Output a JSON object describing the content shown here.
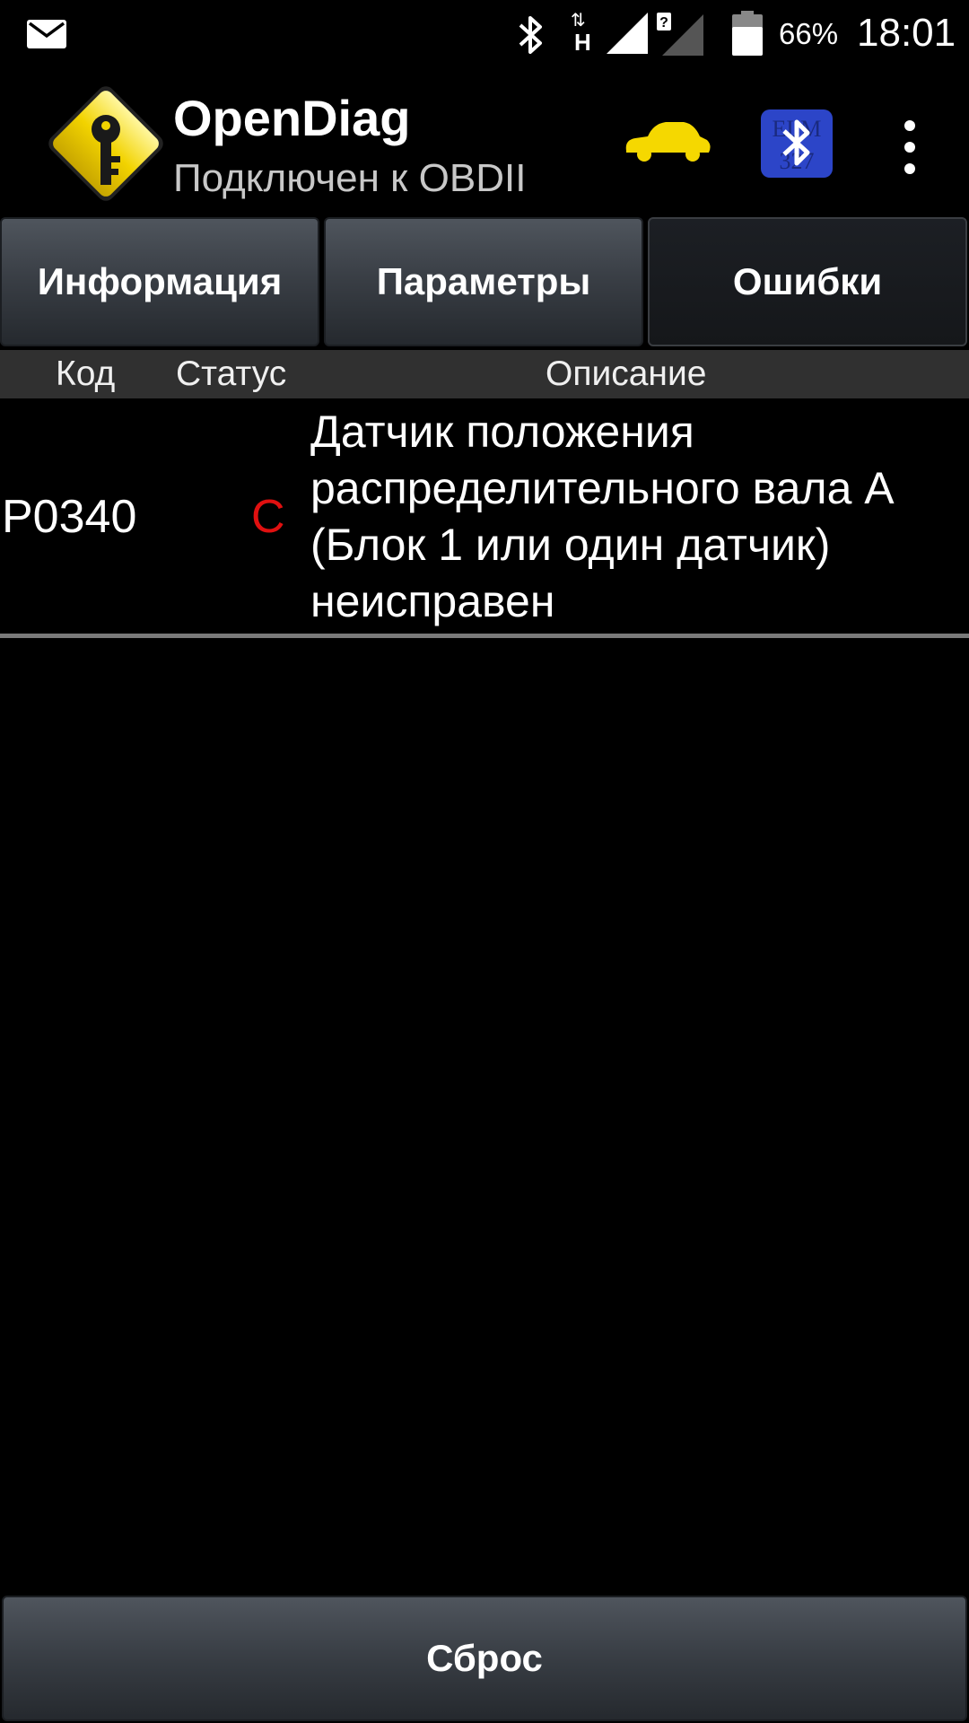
{
  "status_bar": {
    "icons": [
      "mail-icon",
      "bluetooth-icon",
      "data-h-icon",
      "signal-icon",
      "signal-unknown-icon",
      "battery-icon"
    ],
    "data_label": "H",
    "battery": "66%",
    "time": "18:01"
  },
  "action_bar": {
    "title": "OpenDiag",
    "subtitle": "Подключен к OBDII",
    "icons": [
      "app-logo-icon",
      "car-icon",
      "elm327-bluetooth-icon",
      "overflow-menu-icon"
    ]
  },
  "tabs": [
    {
      "label": "Информация",
      "active": false
    },
    {
      "label": "Параметры",
      "active": false
    },
    {
      "label": "Ошибки",
      "active": true
    }
  ],
  "table": {
    "headers": {
      "code": "Код",
      "status": "Статус",
      "description": "Описание"
    },
    "rows": [
      {
        "code": "P0340",
        "status": "C",
        "description": "Датчик положения распределительного вала A (Блок 1 или один датчик) неисправен"
      }
    ]
  },
  "reset_button": {
    "label": "Сброс"
  },
  "colors": {
    "background": "#000000",
    "status_red": "#e01010",
    "logo_yellow": "#f2d300",
    "header_bg": "#303030"
  }
}
